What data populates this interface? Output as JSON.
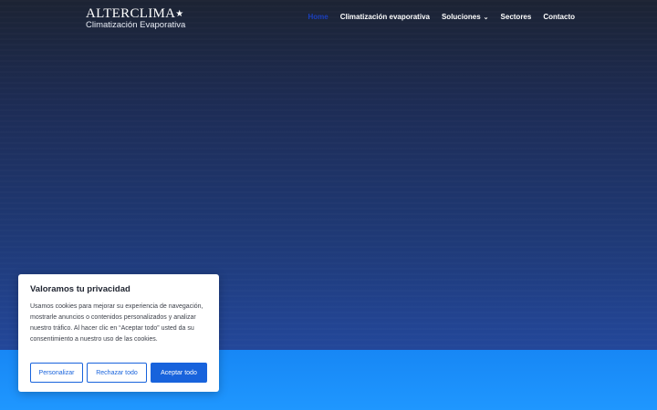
{
  "brand": {
    "name": "ALTERCLIMA",
    "tagline": "Climatización Evaporativa",
    "star": "★"
  },
  "nav": {
    "items": [
      {
        "label": "Home"
      },
      {
        "label": "Climatización evaporativa"
      },
      {
        "label": "Soluciones",
        "chevron": "⌄"
      },
      {
        "label": "Sectores"
      },
      {
        "label": "Contacto"
      }
    ]
  },
  "cookie_banner": {
    "title": "Valoramos tu privacidad",
    "text": "Usamos cookies para mejorar su experiencia de navegación, mostrarle anuncios o contenidos personalizados y analizar nuestro tráfico. Al hacer clic en “Aceptar todo” usted da su consentimiento a nuestro uso de las cookies.",
    "customize_label": "Personalizar",
    "reject_label": "Rechazar todo",
    "accept_label": "Aceptar todo"
  },
  "colors": {
    "accent": "#1863dc",
    "nav_active": "#1b3fbd",
    "band": "#1f97ff"
  }
}
